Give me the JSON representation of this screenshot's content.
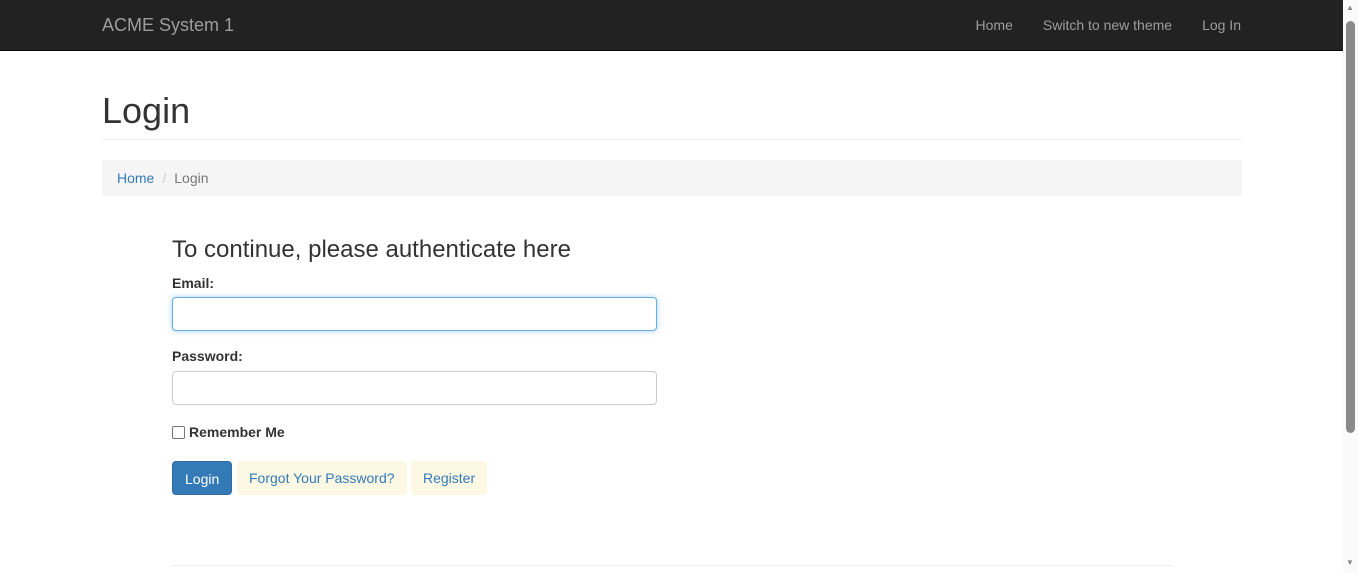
{
  "navbar": {
    "brand": "ACME System 1",
    "links": [
      "Home",
      "Switch to new theme",
      "Log In"
    ]
  },
  "page_title": "Login",
  "breadcrumb": {
    "home": "Home",
    "current": "Login",
    "separator": "/"
  },
  "form": {
    "heading": "To continue, please authenticate here",
    "email_label": "Email:",
    "email_value": "",
    "password_label": "Password:",
    "password_value": "",
    "remember_label": "Remember Me",
    "remember_checked": false,
    "login_button": "Login",
    "forgot_button": "Forgot Your Password?",
    "register_button": "Register"
  }
}
